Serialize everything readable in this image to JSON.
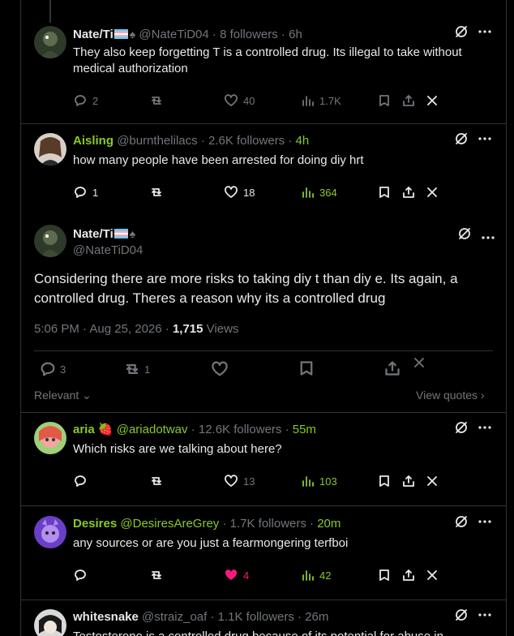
{
  "replies_above": [
    {
      "name": "Nate/Ti",
      "handle": "@NateTiD04",
      "meta": "· 8 followers · 6h",
      "text": "They also keep forgetting T is a controlled drug. Its illegal to take without medical authorization",
      "replies": "2",
      "reposts": "",
      "likes": "40",
      "views": "1.7K"
    },
    {
      "name": "Aisling",
      "handle": "@burnthelilacs",
      "meta": "· 2.6K followers ·",
      "meta_time": "4h",
      "text": "how many people have been arrested for doing diy hrt",
      "replies": "1",
      "reposts": "",
      "likes": "18",
      "views": "364"
    }
  ],
  "main_tweet": {
    "name": "Nate/Ti",
    "handle": "@NateTiD04",
    "text": "Considering there are more risks to taking diy t than diy e. Its again, a controlled drug. Theres a reason why its a controlled drug",
    "time": "5:06 PM · Aug 25, 2026 ·",
    "views_count": "1,715",
    "views_label": "Views",
    "replies": "3",
    "reposts": "1"
  },
  "sort_label": "Relevant",
  "view_quotes_label": "View quotes",
  "replies_below": [
    {
      "name": "aria",
      "emoji": "🍓",
      "handle": "@ariadotwav",
      "meta": "· 12.6K followers ·",
      "meta_time": "55m",
      "text": "Which risks are we talking about here?",
      "likes": "13",
      "views": "103"
    },
    {
      "name": "Desires",
      "handle": "@DesiresAreGrey",
      "meta": "· 1.7K followers ·",
      "meta_time": "20m",
      "text": "any sources or are you just a fearmongering terfboi",
      "likes": "4",
      "views": "42"
    },
    {
      "name": "whitesnake",
      "handle": "@straiz_oaf",
      "meta": "· 1.1K followers · 26m",
      "text": "Testosterone is a controlled drug because of its potential for abuse in"
    }
  ],
  "colors": {
    "accent_green": "#8ac926",
    "like_pink": "#f91880",
    "text": "#e7e9ea",
    "muted": "#71767b"
  }
}
